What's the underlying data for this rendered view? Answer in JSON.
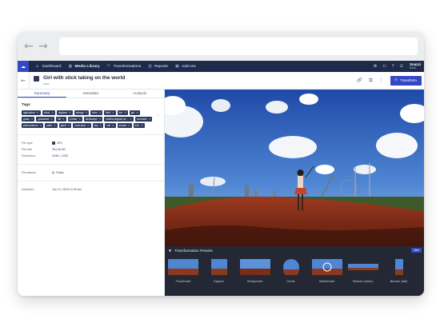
{
  "browser": {
    "back_arrow": "←",
    "forward_arrow": "→"
  },
  "nav": {
    "logo": "☁",
    "items": [
      {
        "label": "Dashboard",
        "icon": "home-icon",
        "glyph": "⌂"
      },
      {
        "label": "Media Library",
        "icon": "media-library-icon",
        "glyph": "▦"
      },
      {
        "label": "Transformations",
        "icon": "transformations-icon",
        "glyph": "⤧"
      },
      {
        "label": "Reports",
        "icon": "reports-icon",
        "glyph": "▥"
      },
      {
        "label": "Add-ons",
        "icon": "addons-icon",
        "glyph": "▣"
      }
    ],
    "right_icons": [
      "⚙",
      "☖",
      "?",
      "☷"
    ],
    "user_name": "Snazzi",
    "user_role": "Basic"
  },
  "header": {
    "title": "Girl with stick taking on the world",
    "breadcrumb": "stock",
    "transform_label": "Transform",
    "icons": [
      "🔗",
      "⧉",
      "⋮"
    ]
  },
  "tabs": [
    "Summary",
    "Metadata",
    "Analysis"
  ],
  "tags_label": "Tags",
  "tags": [
    "agriculture",
    "cloud",
    "daytime",
    "energy",
    "farm",
    "field",
    "fun",
    "girl",
    "grass",
    "grassland",
    "hill",
    "human",
    "landscape",
    "meteorological ph...",
    "mountain",
    "phenomenon",
    "plain",
    "plant",
    "rural area",
    "sky",
    "soil",
    "sunset",
    "tree"
  ],
  "details": [
    {
      "label": "File type",
      "value": "JPG"
    },
    {
      "label": "File size",
      "value": "304.06 KB"
    },
    {
      "label": "Resolution",
      "value": "2048 × 1252"
    }
  ],
  "permission": {
    "label": "Permission",
    "value": "Public"
  },
  "uploaded": {
    "label": "Uploaded",
    "value": "Jun 13, 2018 10:49 am"
  },
  "presets": {
    "title": "Transformation Presets",
    "new_label": "New",
    "items": [
      "Thumbnail",
      "Square",
      "Sharpened",
      "Circle",
      "Watermark",
      "Banner (wide)",
      "Banner (tall)"
    ]
  },
  "colors": {
    "accent": "#3448c5",
    "nav_bg": "#1d2a49",
    "tag_bg": "#2b3a5c",
    "preset_bg": "#232834"
  }
}
